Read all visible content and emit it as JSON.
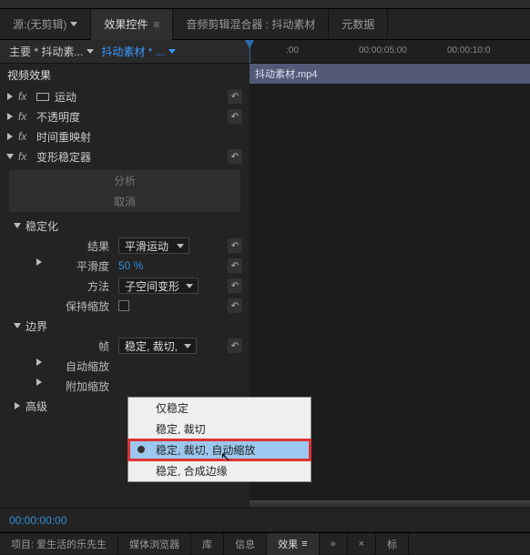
{
  "tabs": {
    "source": "源:(无剪辑)",
    "effect_controls": "效果控件",
    "audio_mixer": "音频剪辑混合器 : 抖动素材",
    "metadata": "元数据"
  },
  "source_header": {
    "left": "主要 * 抖动素...",
    "right": "抖动素材 * ..."
  },
  "ruler": {
    "t0": ":00",
    "t1": "00:00:05:00",
    "t2": "00:00:10:0"
  },
  "clip_name": "抖动素材.mp4",
  "sections": {
    "video_effects": "视频效果",
    "motion": "运动",
    "opacity": "不透明度",
    "time_remap": "时间重映射",
    "warp": "变形稳定器"
  },
  "buttons": {
    "analyze": "分析",
    "cancel": "取消"
  },
  "groups": {
    "stabilize": "稳定化",
    "border": "边界",
    "advanced": "高级"
  },
  "params": {
    "result": {
      "label": "结果",
      "value": "平滑运动"
    },
    "smoothness": {
      "label": "平滑度",
      "value": "50 %"
    },
    "method": {
      "label": "方法",
      "value": "子空间变形"
    },
    "keep_scale": {
      "label": "保持缩放"
    },
    "frame": {
      "label": "帧",
      "value": "稳定, 裁切, "
    },
    "auto_scale": {
      "label": "自动缩放"
    },
    "extra_scale": {
      "label": "附加缩放"
    }
  },
  "context_menu": {
    "items": [
      "仅稳定",
      "稳定, 裁切",
      "稳定, 裁切, 自动缩放",
      "稳定, 合成边缘"
    ],
    "selected_index": 2
  },
  "current_time": "00:00:00:00",
  "bottom_tabs": {
    "project": "项目: 爱生活的乐先生",
    "media_browser": "媒体浏览器",
    "library": "库",
    "info": "信息",
    "effects": "效果",
    "markers": "标"
  },
  "glyphs": {
    "reset": "↶",
    "menu": "≡",
    "more": "»",
    "close": "×",
    "cursor": "↖"
  }
}
